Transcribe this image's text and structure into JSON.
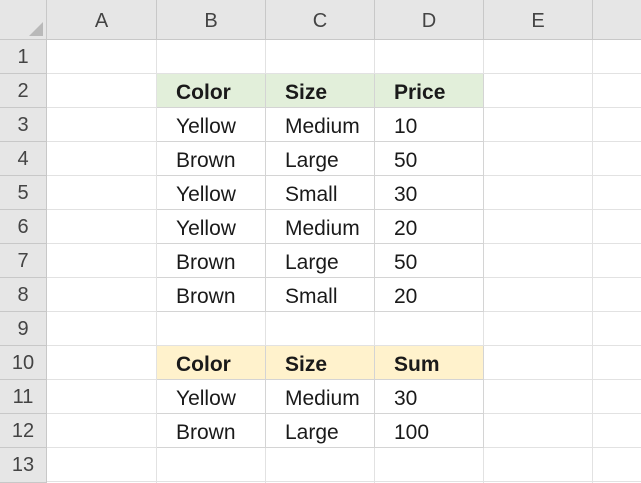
{
  "columns": [
    "A",
    "B",
    "C",
    "D",
    "E"
  ],
  "rows": [
    "1",
    "2",
    "3",
    "4",
    "5",
    "6",
    "7",
    "8",
    "9",
    "10",
    "11",
    "12",
    "13"
  ],
  "table1": {
    "header": [
      "Color",
      "Size",
      "Price"
    ],
    "rows": [
      [
        "Yellow",
        "Medium",
        "10"
      ],
      [
        "Brown",
        "Large",
        "50"
      ],
      [
        "Yellow",
        "Small",
        "30"
      ],
      [
        "Yellow",
        "Medium",
        "20"
      ],
      [
        "Brown",
        "Large",
        "50"
      ],
      [
        "Brown",
        "Small",
        "20"
      ]
    ],
    "header_color": "#e2efda"
  },
  "table2": {
    "header": [
      "Color",
      "Size",
      "Sum"
    ],
    "rows": [
      [
        "Yellow",
        "Medium",
        "30"
      ],
      [
        "Brown",
        "Large",
        "100"
      ]
    ],
    "header_color": "#fff2cc"
  }
}
